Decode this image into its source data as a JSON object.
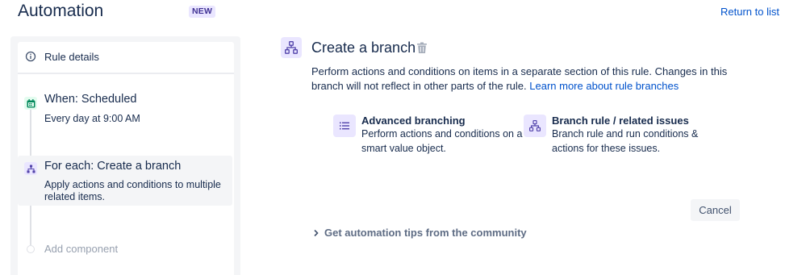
{
  "header": {
    "title": "Automation",
    "badge": "NEW",
    "return_link": "Return to list"
  },
  "sidebar": {
    "rule_details": {
      "icon": "info-icon",
      "label": "Rule details"
    },
    "steps": [
      {
        "icon": "calendar-icon",
        "title": "When: Scheduled",
        "description": "Every day at 9:00 AM",
        "accent": "#00875a"
      },
      {
        "icon": "branch-icon",
        "title": "For each: Create a branch",
        "description": "Apply actions and conditions to multiple related items.",
        "accent": "#5243aa"
      }
    ],
    "add_component": "Add component"
  },
  "main": {
    "title": "Create a branch",
    "description": "Perform actions and conditions on items in a separate section of this rule. Changes in this branch will not reflect in other parts of the rule.",
    "learn_more_link": "Learn more about rule branches",
    "options": [
      {
        "icon": "list-icon",
        "title": "Advanced branching",
        "description": "Perform actions and conditions on a smart value object."
      },
      {
        "icon": "branch-icon",
        "title": "Branch rule / related issues",
        "description": "Branch rule and run conditions & actions for these issues."
      }
    ],
    "cancel_label": "Cancel",
    "tips_label": "Get automation tips from the community"
  },
  "colors": {
    "brand_purple": "#5243aa",
    "purple_bg": "#eae6ff",
    "link_blue": "#0052cc",
    "green": "#00875a"
  }
}
